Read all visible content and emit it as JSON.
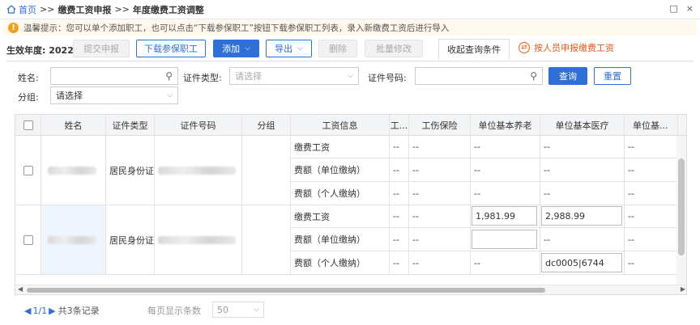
{
  "breadcrumb": {
    "home": "首页",
    "sep1": ">>",
    "level1": "缴费工资申报",
    "sep2": ">>",
    "level2": "年度缴费工资调整"
  },
  "window_buttons": {
    "restore": "□",
    "close": "×"
  },
  "tip": {
    "icon": "!",
    "text": "温馨提示：您可以单个添加职工，也可以点击“下载参保职工”按钮下载参保职工列表，录入新缴费工资后进行导入"
  },
  "toolbar": {
    "year_label": "生效年度:",
    "year_value": "2022",
    "submit": "提交申报",
    "download": "下载参保职工",
    "add": "添加",
    "export": "导出",
    "delete": "删除",
    "batch_edit": "批量修改",
    "collapse_query": "收起查询条件",
    "declare_by_person": "按人员申报缴费工资"
  },
  "search": {
    "name_label": "姓名:",
    "name_value": "",
    "cert_type_label": "证件类型:",
    "cert_type_placeholder": "请选择",
    "cert_no_label": "证件号码:",
    "cert_no_value": "",
    "group_label": "分组:",
    "group_value": "请选择",
    "query": "查询",
    "reset": "重置"
  },
  "table": {
    "headers": [
      "姓名",
      "证件类型",
      "证件号码",
      "分组",
      "工资信息",
      "工...",
      "工伤保险",
      "单位基本养老",
      "单位基本医疗",
      "单位基..."
    ],
    "rows": [
      {
        "cert_type": "居民身份证",
        "sub": [
          {
            "info": "缴费工资",
            "c1": "--",
            "c2": "--",
            "c3": "--",
            "c4": "--",
            "c5": "--"
          },
          {
            "info": "费额（单位缴纳）",
            "c1": "--",
            "c2": "--",
            "c3": "--",
            "c4": "--",
            "c5": "--"
          },
          {
            "info": "费额（个人缴纳）",
            "c1": "--",
            "c2": "--",
            "c3": "--",
            "c4": "--",
            "c5": "--"
          }
        ]
      },
      {
        "cert_type": "居民身份证",
        "sub": [
          {
            "info": "缴费工资",
            "c1": "--",
            "c2": "--",
            "c3": "1,981.99",
            "c4": "2,988.99",
            "c5": "--"
          },
          {
            "info": "费额（单位缴纳）",
            "c1": "--",
            "c2": "--",
            "c3": "",
            "c4": "--",
            "c5": "--"
          },
          {
            "info": "费额（个人缴纳）",
            "c1": "--",
            "c2": "--",
            "c3": "--",
            "c4": "dc0005|6744",
            "c5": "--"
          }
        ]
      }
    ]
  },
  "pagination": {
    "page": "1/1",
    "total": "共3条记录",
    "page_size_label": "每页显示条数",
    "page_size": "50"
  }
}
